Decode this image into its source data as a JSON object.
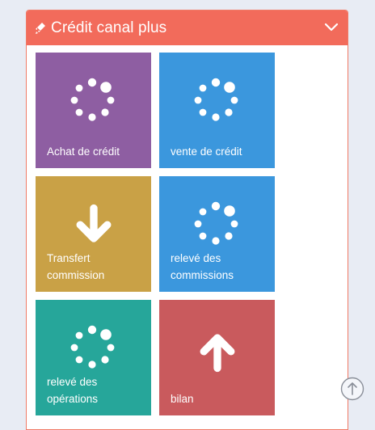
{
  "panel": {
    "title": "Crédit canal plus",
    "header_icon": "rocket-icon",
    "collapse_icon": "chevron-down-icon",
    "colors": {
      "header": "#f26b5b",
      "border": "#f07a66"
    }
  },
  "tiles": [
    {
      "label": "Achat de crédit",
      "icon": "loading-spinner-icon",
      "color": "#8e5ea2"
    },
    {
      "label": "vente de crédit",
      "icon": "loading-spinner-icon",
      "color": "#3b97dd"
    },
    {
      "label": "Transfert\ncommission",
      "icon": "arrow-down-icon",
      "color": "#c9a146"
    },
    {
      "label": "relevé des\ncommissions",
      "icon": "loading-spinner-icon",
      "color": "#3b97dd"
    },
    {
      "label": "relevé des\nopérations",
      "icon": "loading-spinner-icon",
      "color": "#26a69a"
    },
    {
      "label": "bilan",
      "icon": "arrow-up-icon",
      "color": "#c95a5d"
    }
  ],
  "scroll_top": {
    "icon": "arrow-up-circle-icon"
  }
}
